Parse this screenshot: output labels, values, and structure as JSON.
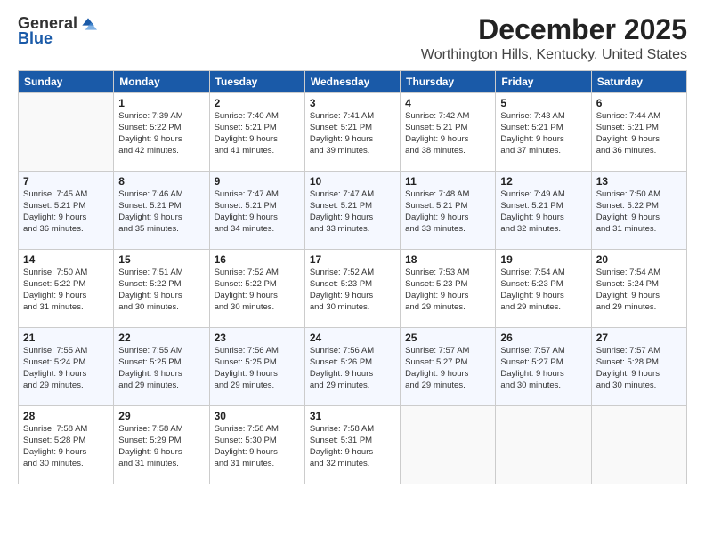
{
  "header": {
    "logo_general": "General",
    "logo_blue": "Blue",
    "month": "December 2025",
    "location": "Worthington Hills, Kentucky, United States"
  },
  "weekdays": [
    "Sunday",
    "Monday",
    "Tuesday",
    "Wednesday",
    "Thursday",
    "Friday",
    "Saturday"
  ],
  "weeks": [
    [
      {
        "num": "",
        "info": ""
      },
      {
        "num": "1",
        "info": "Sunrise: 7:39 AM\nSunset: 5:22 PM\nDaylight: 9 hours\nand 42 minutes."
      },
      {
        "num": "2",
        "info": "Sunrise: 7:40 AM\nSunset: 5:21 PM\nDaylight: 9 hours\nand 41 minutes."
      },
      {
        "num": "3",
        "info": "Sunrise: 7:41 AM\nSunset: 5:21 PM\nDaylight: 9 hours\nand 39 minutes."
      },
      {
        "num": "4",
        "info": "Sunrise: 7:42 AM\nSunset: 5:21 PM\nDaylight: 9 hours\nand 38 minutes."
      },
      {
        "num": "5",
        "info": "Sunrise: 7:43 AM\nSunset: 5:21 PM\nDaylight: 9 hours\nand 37 minutes."
      },
      {
        "num": "6",
        "info": "Sunrise: 7:44 AM\nSunset: 5:21 PM\nDaylight: 9 hours\nand 36 minutes."
      }
    ],
    [
      {
        "num": "7",
        "info": "Sunrise: 7:45 AM\nSunset: 5:21 PM\nDaylight: 9 hours\nand 36 minutes."
      },
      {
        "num": "8",
        "info": "Sunrise: 7:46 AM\nSunset: 5:21 PM\nDaylight: 9 hours\nand 35 minutes."
      },
      {
        "num": "9",
        "info": "Sunrise: 7:47 AM\nSunset: 5:21 PM\nDaylight: 9 hours\nand 34 minutes."
      },
      {
        "num": "10",
        "info": "Sunrise: 7:47 AM\nSunset: 5:21 PM\nDaylight: 9 hours\nand 33 minutes."
      },
      {
        "num": "11",
        "info": "Sunrise: 7:48 AM\nSunset: 5:21 PM\nDaylight: 9 hours\nand 33 minutes."
      },
      {
        "num": "12",
        "info": "Sunrise: 7:49 AM\nSunset: 5:21 PM\nDaylight: 9 hours\nand 32 minutes."
      },
      {
        "num": "13",
        "info": "Sunrise: 7:50 AM\nSunset: 5:22 PM\nDaylight: 9 hours\nand 31 minutes."
      }
    ],
    [
      {
        "num": "14",
        "info": "Sunrise: 7:50 AM\nSunset: 5:22 PM\nDaylight: 9 hours\nand 31 minutes."
      },
      {
        "num": "15",
        "info": "Sunrise: 7:51 AM\nSunset: 5:22 PM\nDaylight: 9 hours\nand 30 minutes."
      },
      {
        "num": "16",
        "info": "Sunrise: 7:52 AM\nSunset: 5:22 PM\nDaylight: 9 hours\nand 30 minutes."
      },
      {
        "num": "17",
        "info": "Sunrise: 7:52 AM\nSunset: 5:23 PM\nDaylight: 9 hours\nand 30 minutes."
      },
      {
        "num": "18",
        "info": "Sunrise: 7:53 AM\nSunset: 5:23 PM\nDaylight: 9 hours\nand 29 minutes."
      },
      {
        "num": "19",
        "info": "Sunrise: 7:54 AM\nSunset: 5:23 PM\nDaylight: 9 hours\nand 29 minutes."
      },
      {
        "num": "20",
        "info": "Sunrise: 7:54 AM\nSunset: 5:24 PM\nDaylight: 9 hours\nand 29 minutes."
      }
    ],
    [
      {
        "num": "21",
        "info": "Sunrise: 7:55 AM\nSunset: 5:24 PM\nDaylight: 9 hours\nand 29 minutes."
      },
      {
        "num": "22",
        "info": "Sunrise: 7:55 AM\nSunset: 5:25 PM\nDaylight: 9 hours\nand 29 minutes."
      },
      {
        "num": "23",
        "info": "Sunrise: 7:56 AM\nSunset: 5:25 PM\nDaylight: 9 hours\nand 29 minutes."
      },
      {
        "num": "24",
        "info": "Sunrise: 7:56 AM\nSunset: 5:26 PM\nDaylight: 9 hours\nand 29 minutes."
      },
      {
        "num": "25",
        "info": "Sunrise: 7:57 AM\nSunset: 5:27 PM\nDaylight: 9 hours\nand 29 minutes."
      },
      {
        "num": "26",
        "info": "Sunrise: 7:57 AM\nSunset: 5:27 PM\nDaylight: 9 hours\nand 30 minutes."
      },
      {
        "num": "27",
        "info": "Sunrise: 7:57 AM\nSunset: 5:28 PM\nDaylight: 9 hours\nand 30 minutes."
      }
    ],
    [
      {
        "num": "28",
        "info": "Sunrise: 7:58 AM\nSunset: 5:28 PM\nDaylight: 9 hours\nand 30 minutes."
      },
      {
        "num": "29",
        "info": "Sunrise: 7:58 AM\nSunset: 5:29 PM\nDaylight: 9 hours\nand 31 minutes."
      },
      {
        "num": "30",
        "info": "Sunrise: 7:58 AM\nSunset: 5:30 PM\nDaylight: 9 hours\nand 31 minutes."
      },
      {
        "num": "31",
        "info": "Sunrise: 7:58 AM\nSunset: 5:31 PM\nDaylight: 9 hours\nand 32 minutes."
      },
      {
        "num": "",
        "info": ""
      },
      {
        "num": "",
        "info": ""
      },
      {
        "num": "",
        "info": ""
      }
    ]
  ]
}
